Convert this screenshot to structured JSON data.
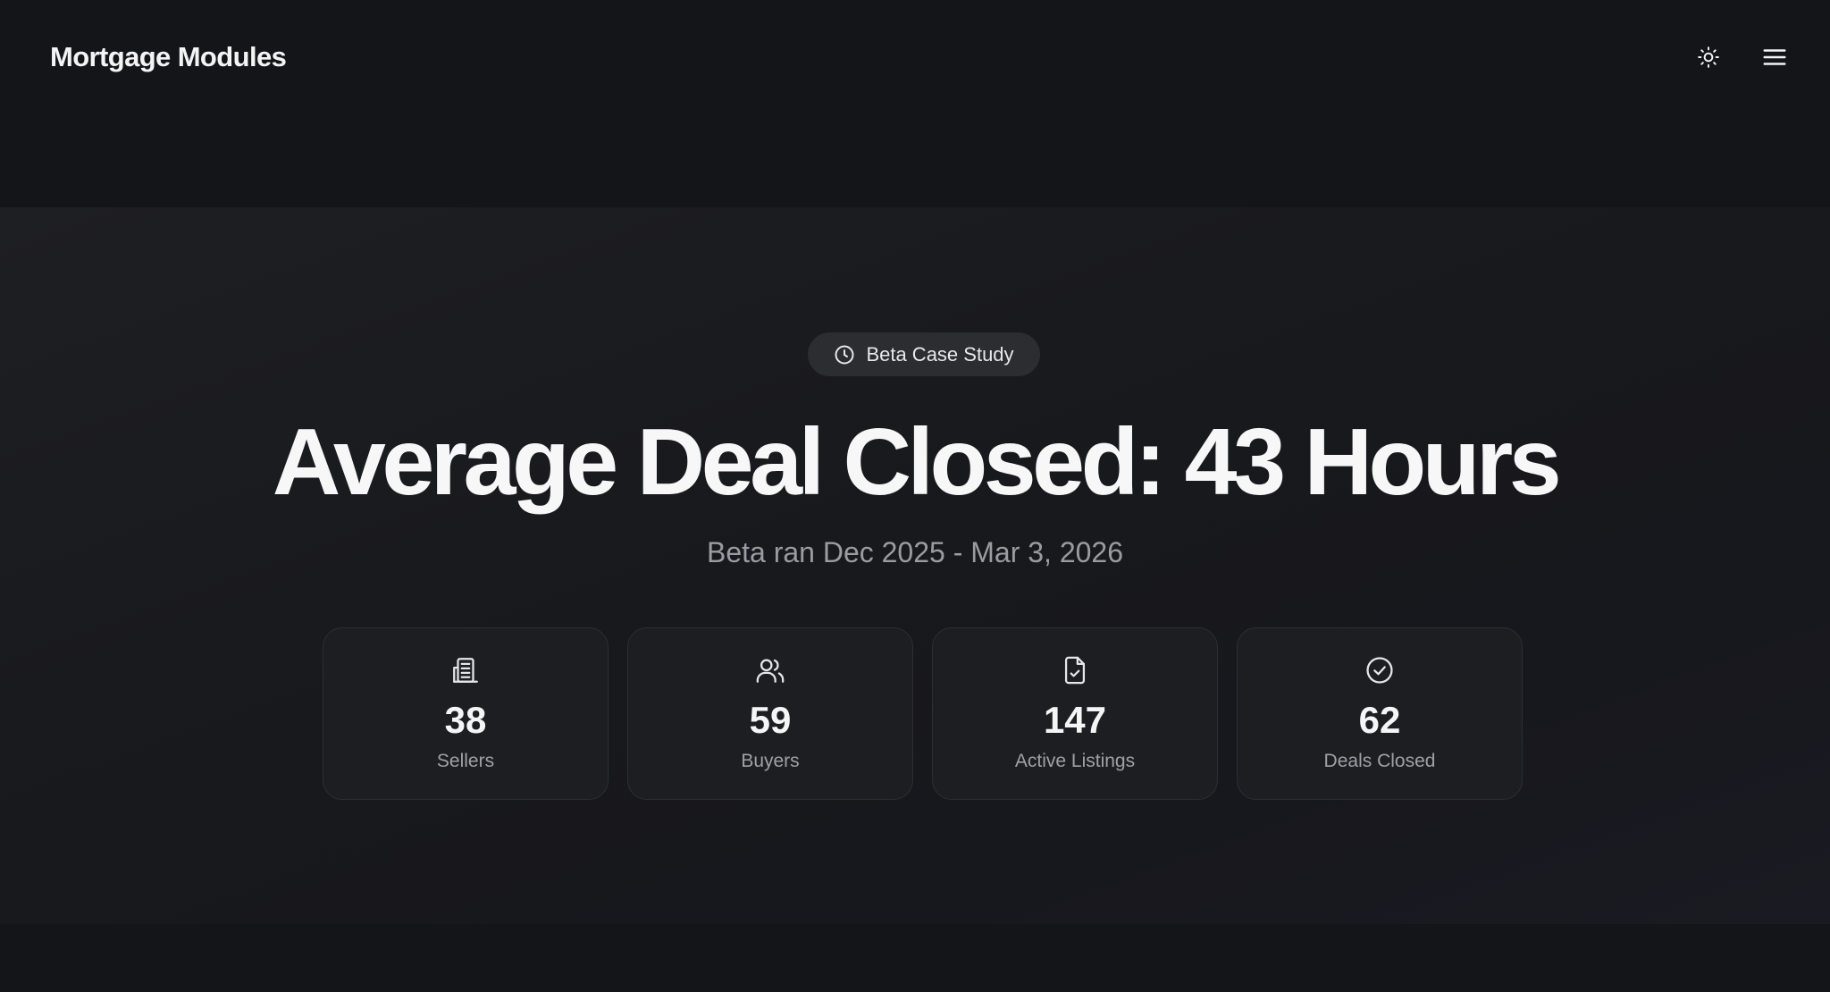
{
  "header": {
    "brand": "Mortgage Modules",
    "theme_toggle_icon": "sun-icon",
    "menu_icon": "hamburger-menu-icon"
  },
  "hero": {
    "badge": {
      "icon": "clock-icon",
      "label": "Beta Case Study"
    },
    "headline": "Average Deal Closed: 43 Hours",
    "subtitle": "Beta ran Dec 2025 - Mar 3, 2026",
    "stats": [
      {
        "icon": "building-icon",
        "value": "38",
        "label": "Sellers"
      },
      {
        "icon": "users-icon",
        "value": "59",
        "label": "Buyers"
      },
      {
        "icon": "file-check-icon",
        "value": "147",
        "label": "Active Listings"
      },
      {
        "icon": "check-circle-icon",
        "value": "62",
        "label": "Deals Closed"
      }
    ]
  },
  "colors": {
    "background": "#141518",
    "hero_background": "#1b1c20",
    "card_background": "#1d1e22",
    "card_border": "#2d2e33",
    "text_primary": "#f5f5f6",
    "text_muted": "#9b9ca3"
  }
}
